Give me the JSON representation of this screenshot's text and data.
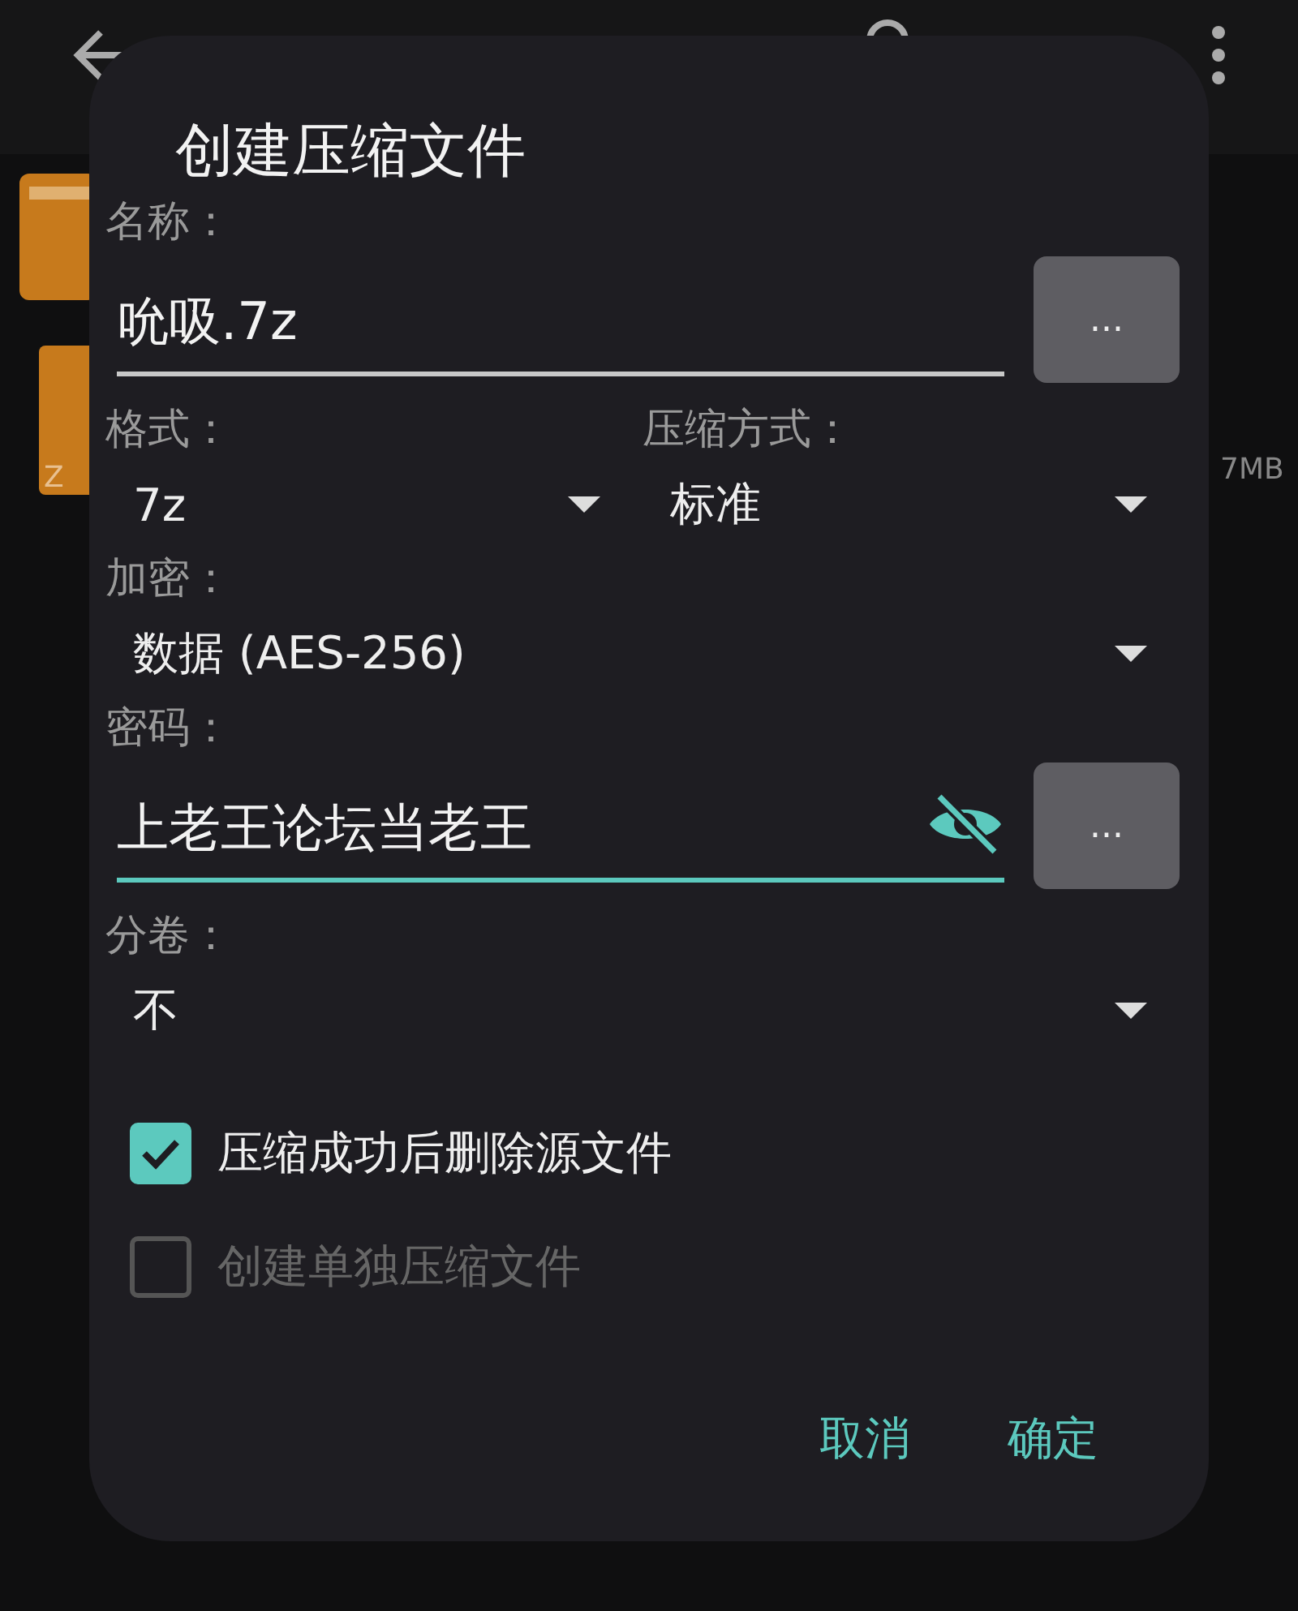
{
  "background": {
    "files": [
      {
        "kind": "folder"
      },
      {
        "kind": "archive",
        "badge": "Z",
        "size": "7MB"
      }
    ]
  },
  "dialog": {
    "title": "创建压缩文件",
    "name": {
      "label": "名称：",
      "value": "吮吸.7z",
      "focused": false,
      "browse": "..."
    },
    "format": {
      "label": "格式：",
      "value": "7z"
    },
    "method": {
      "label": "压缩方式：",
      "value": "标准"
    },
    "encryption": {
      "label": "加密：",
      "value": "数据 (AES-256)"
    },
    "password": {
      "label": "密码：",
      "value": "上老王论坛当老王",
      "focused": true,
      "visible": true,
      "browse": "..."
    },
    "split": {
      "label": "分卷：",
      "value": "不"
    },
    "options": [
      {
        "label": "压缩成功后删除源文件",
        "checked": true,
        "disabled": false
      },
      {
        "label": "创建单独压缩文件",
        "checked": false,
        "disabled": true
      }
    ],
    "buttons": [
      "取消",
      "确定"
    ]
  }
}
